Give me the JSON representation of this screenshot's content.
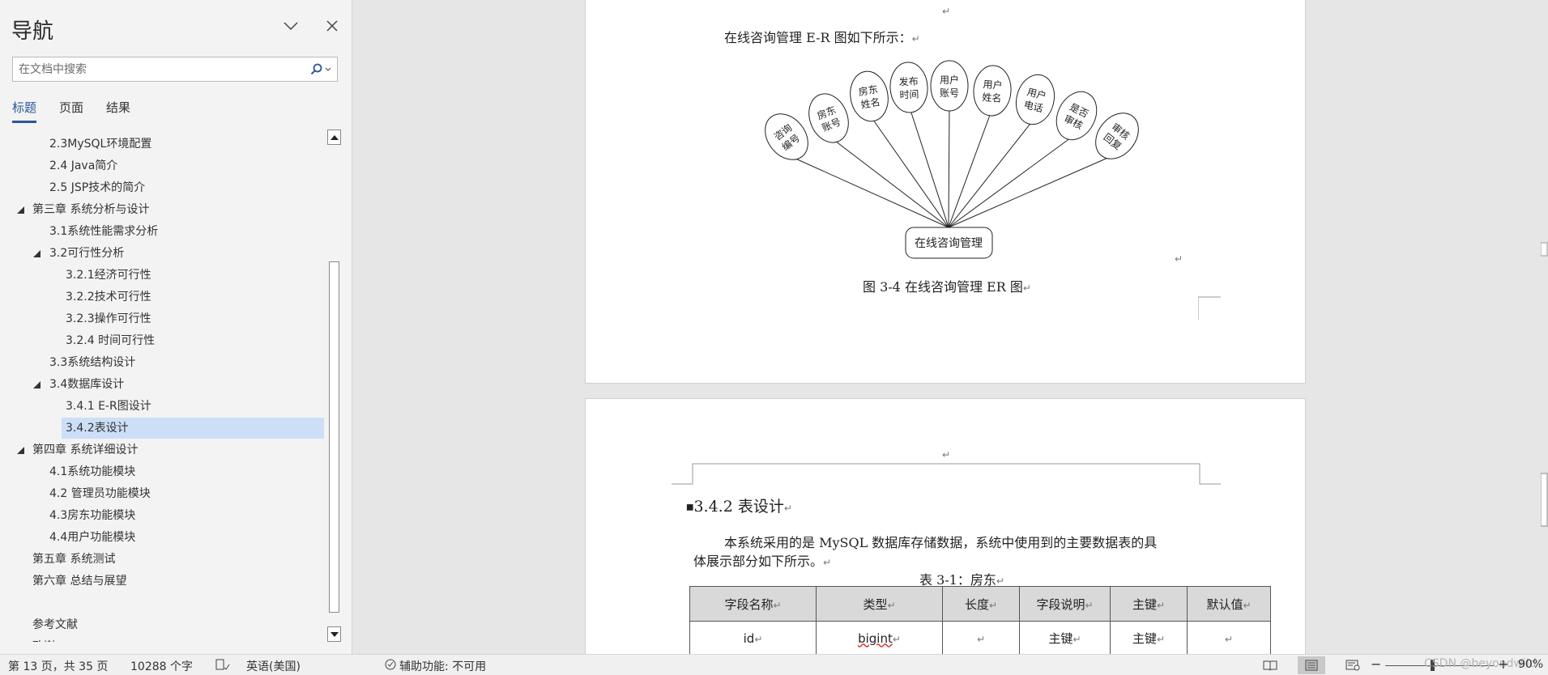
{
  "nav": {
    "title": "导航",
    "search_placeholder": "在文档中搜索",
    "tabs": [
      {
        "label": "标题",
        "active": true
      },
      {
        "label": "页面",
        "active": false
      },
      {
        "label": "结果",
        "active": false
      }
    ],
    "headings": [
      {
        "label": "2.3MySQL环境配置",
        "level": 2,
        "toggle": false
      },
      {
        "label": "2.4 Java简介",
        "level": 2,
        "toggle": false
      },
      {
        "label": "2.5 JSP技术的简介",
        "level": 2,
        "toggle": false
      },
      {
        "label": "第三章 系统分析与设计",
        "level": 1,
        "toggle": true
      },
      {
        "label": "3.1系统性能需求分析",
        "level": 2,
        "toggle": false
      },
      {
        "label": "3.2可行性分析",
        "level": 2,
        "toggle": true
      },
      {
        "label": "3.2.1经济可行性",
        "level": 3,
        "toggle": false
      },
      {
        "label": "3.2.2技术可行性",
        "level": 3,
        "toggle": false
      },
      {
        "label": "3.2.3操作可行性",
        "level": 3,
        "toggle": false
      },
      {
        "label": "3.2.4 时间可行性",
        "level": 3,
        "toggle": false
      },
      {
        "label": "3.3系统结构设计",
        "level": 2,
        "toggle": false
      },
      {
        "label": "3.4数据库设计",
        "level": 2,
        "toggle": true
      },
      {
        "label": "3.4.1 E-R图设计",
        "level": 3,
        "toggle": false
      },
      {
        "label": "3.4.2表设计",
        "level": 3,
        "toggle": false,
        "selected": true
      },
      {
        "label": "第四章 系统详细设计",
        "level": 1,
        "toggle": true
      },
      {
        "label": "4.1系统功能模块",
        "level": 2,
        "toggle": false
      },
      {
        "label": "4.2 管理员功能模块",
        "level": 2,
        "toggle": false
      },
      {
        "label": "4.3房东功能模块",
        "level": 2,
        "toggle": false
      },
      {
        "label": "4.4用户功能模块",
        "level": 2,
        "toggle": false
      },
      {
        "label": "第五章 系统测试",
        "level": 1,
        "toggle": false
      },
      {
        "label": "第六章 总结与展望",
        "level": 1,
        "toggle": false
      },
      {
        "label": "",
        "level": 1,
        "toggle": false
      },
      {
        "label": "参考文献",
        "level": 1,
        "toggle": false
      },
      {
        "label": "致谢",
        "level": 1,
        "toggle": false
      }
    ]
  },
  "document": {
    "page1": {
      "intro": "在线咨询管理 E-R 图如下所示：",
      "caption": "图 3-4 在线咨询管理 ER 图",
      "er": {
        "entity": "在线咨询管理",
        "attributes": [
          {
            "line1": "咨询",
            "line2": "编号"
          },
          {
            "line1": "房东",
            "line2": "账号"
          },
          {
            "line1": "房东",
            "line2": "姓名"
          },
          {
            "line1": "发布",
            "line2": "时间"
          },
          {
            "line1": "用户",
            "line2": "账号"
          },
          {
            "line1": "用户",
            "line2": "姓名"
          },
          {
            "line1": "用户",
            "line2": "电话"
          },
          {
            "line1": "是否",
            "line2": "审核"
          },
          {
            "line1": "审核",
            "line2": "回复"
          }
        ]
      }
    },
    "page2": {
      "heading": "3.4.2 表设计",
      "para_line1": "本系统采用的是 MySQL 数据库存储数据，系统中使用到的主要数据表的具",
      "para_line2": "体展示部分如下所示。",
      "table_caption": "表 3-1：房东",
      "table": {
        "headers": [
          "字段名称",
          "类型",
          "长度",
          "字段说明",
          "主键",
          "默认值"
        ],
        "rows": [
          [
            "id",
            "bigint",
            "",
            "主键",
            "主键",
            ""
          ]
        ]
      }
    },
    "para_mark": "↵"
  },
  "status": {
    "page": "第 13 页，共 35 页",
    "words": "10288 个字",
    "language": "英语(美国)",
    "accessibility": "辅助功能: 不可用",
    "zoom": "90%",
    "watermark": "CSDN @beyondwild"
  }
}
